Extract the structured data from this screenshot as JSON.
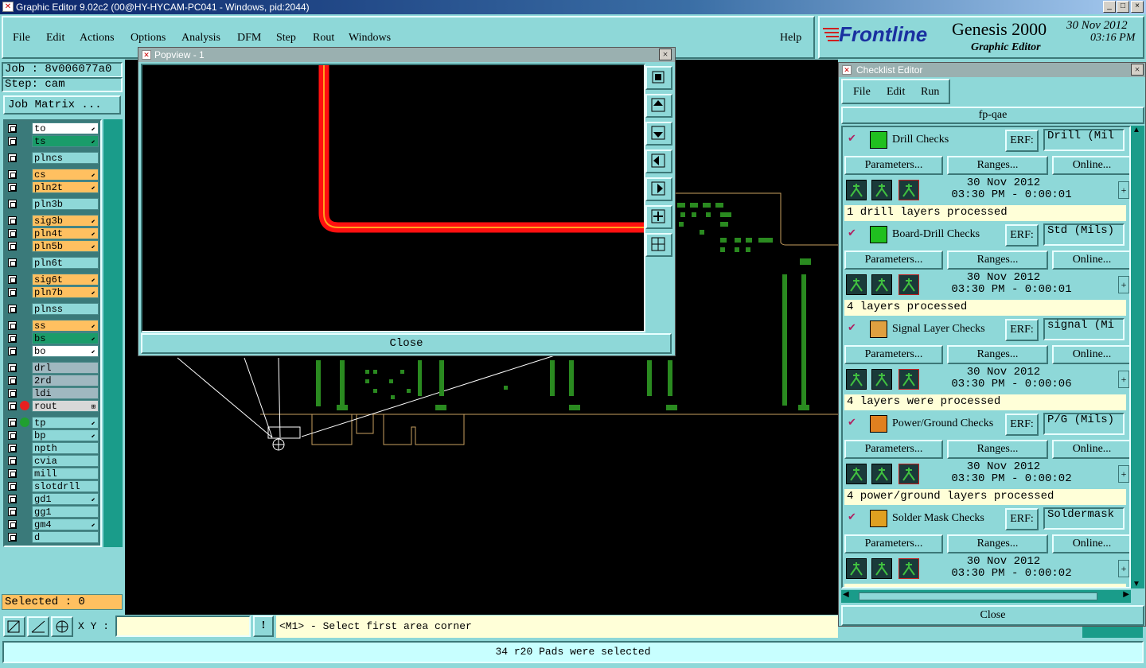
{
  "window": {
    "title": "Graphic Editor 9.02c2 (00@HY-HYCAM-PC041 - Windows, pid:2044)",
    "min": "_",
    "max": "□",
    "close": "×"
  },
  "menu": {
    "items": [
      "File",
      "Edit",
      "Actions",
      "Options",
      "Analysis",
      "DFM",
      "Step",
      "Rout",
      "Windows"
    ],
    "help": "Help"
  },
  "brand": {
    "logo": "Frontline",
    "product": "Genesis 2000",
    "subtitle": "Graphic Editor",
    "date": "30 Nov 2012",
    "time": "03:16 PM"
  },
  "left": {
    "job": "Job : 8v006077a0",
    "step": "Step: cam",
    "matrix_btn": "Job Matrix ...",
    "selected": "Selected : 0"
  },
  "layers": [
    {
      "name": "to",
      "bg": "#ffffff",
      "arrow": "⬋",
      "mark": ""
    },
    {
      "name": "ts",
      "bg": "#1a9c6a",
      "arrow": "⬋",
      "mark": ""
    },
    {
      "name": "plncs",
      "bg": "#8ed8d8",
      "arrow": "",
      "mark": ""
    },
    {
      "name": "cs",
      "bg": "#ffc060",
      "arrow": "⬋",
      "mark": ""
    },
    {
      "name": "pln2t",
      "bg": "#ffc060",
      "arrow": "⬋",
      "mark": ""
    },
    {
      "name": "pln3b",
      "bg": "#8ed8d8",
      "arrow": "",
      "mark": ""
    },
    {
      "name": "sig3b",
      "bg": "#ffc060",
      "arrow": "⬋",
      "mark": ""
    },
    {
      "name": "pln4t",
      "bg": "#ffc060",
      "arrow": "⬋",
      "mark": ""
    },
    {
      "name": "pln5b",
      "bg": "#ffc060",
      "arrow": "⬋",
      "mark": ""
    },
    {
      "name": "pln6t",
      "bg": "#8ed8d8",
      "arrow": "",
      "mark": ""
    },
    {
      "name": "sig6t",
      "bg": "#ffc060",
      "arrow": "⬋",
      "mark": ""
    },
    {
      "name": "pln7b",
      "bg": "#ffc060",
      "arrow": "⬋",
      "mark": ""
    },
    {
      "name": "plnss",
      "bg": "#8ed8d8",
      "arrow": "",
      "mark": ""
    },
    {
      "name": "ss",
      "bg": "#ffc060",
      "arrow": "⬋",
      "mark": ""
    },
    {
      "name": "bs",
      "bg": "#1a9c6a",
      "arrow": "⬋",
      "mark": ""
    },
    {
      "name": "bo",
      "bg": "#ffffff",
      "arrow": "⬋",
      "mark": ""
    },
    {
      "name": "drl",
      "bg": "#a0b8c0",
      "arrow": "",
      "mark": ""
    },
    {
      "name": "2rd",
      "bg": "#a0b8c0",
      "arrow": "",
      "mark": ""
    },
    {
      "name": "ldi",
      "bg": "#a0b8c0",
      "arrow": "",
      "mark": ""
    },
    {
      "name": "rout",
      "bg": "#d8d8d8",
      "arrow": "⊞",
      "mark": "red"
    },
    {
      "name": "tp",
      "bg": "#8ed8d8",
      "arrow": "⬋",
      "mark": "green"
    },
    {
      "name": "bp",
      "bg": "#8ed8d8",
      "arrow": "⬋",
      "mark": ""
    },
    {
      "name": "npth",
      "bg": "#8ed8d8",
      "arrow": "",
      "mark": ""
    },
    {
      "name": "cvia",
      "bg": "#8ed8d8",
      "arrow": "",
      "mark": ""
    },
    {
      "name": "mill",
      "bg": "#8ed8d8",
      "arrow": "",
      "mark": ""
    },
    {
      "name": "slotdrll",
      "bg": "#8ed8d8",
      "arrow": "",
      "mark": ""
    },
    {
      "name": "gd1",
      "bg": "#8ed8d8",
      "arrow": "⬋",
      "mark": ""
    },
    {
      "name": "gg1",
      "bg": "#8ed8d8",
      "arrow": "",
      "mark": ""
    },
    {
      "name": "gm4",
      "bg": "#8ed8d8",
      "arrow": "⬋",
      "mark": ""
    },
    {
      "name": "d",
      "bg": "#8ed8d8",
      "arrow": "",
      "mark": ""
    }
  ],
  "popview": {
    "title": "Popview - 1",
    "close": "Close"
  },
  "checklist": {
    "title": "Checklist Editor",
    "menu": [
      "File",
      "Edit",
      "Run"
    ],
    "name": "fp-qae",
    "close": "Close",
    "erf_label": "ERF:",
    "params": "Parameters...",
    "ranges": "Ranges...",
    "online": "Online...",
    "rows": [
      {
        "name": "Drill Checks",
        "erf": "Drill (Mil",
        "date": "30 Nov 2012",
        "time": "03:30 PM - 0:00:01",
        "status": "1 drill layers processed",
        "icon": "drill-icon",
        "color": "#20c020"
      },
      {
        "name": "Board-Drill Checks",
        "erf": "Std (Mils)",
        "date": "30 Nov 2012",
        "time": "03:30 PM - 0:00:01",
        "status": "4 layers processed",
        "icon": "board-drill-icon",
        "color": "#20c020"
      },
      {
        "name": "Signal Layer Checks",
        "erf": "signal (Mi",
        "date": "30 Nov 2012",
        "time": "03:30 PM - 0:00:06",
        "status": "4 layers were processed",
        "icon": "signal-layer-icon",
        "color": "#e0a040"
      },
      {
        "name": "Power/Ground Checks",
        "erf": "P/G (Mils)",
        "date": "30 Nov 2012",
        "time": "03:30 PM - 0:00:02",
        "status": "4 power/ground layers processed",
        "icon": "power-ground-icon",
        "color": "#e08020"
      },
      {
        "name": "Solder Mask Checks",
        "erf": "Soldermask",
        "date": "30 Nov 2012",
        "time": "03:30 PM - 0:00:02",
        "status": "",
        "icon": "solder-mask-icon",
        "color": "#e0a020"
      }
    ]
  },
  "bottom": {
    "xy_label": "X Y :",
    "xy_value": "",
    "prompt": "<M1> - Select first area corner",
    "excl": "!",
    "status": "34 r20 Pads were selected"
  }
}
